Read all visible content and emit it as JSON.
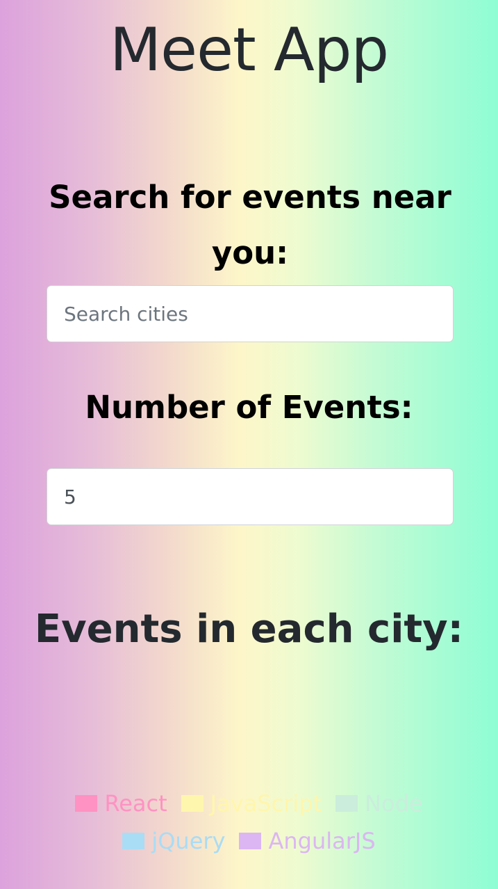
{
  "app": {
    "title": "Meet App"
  },
  "search": {
    "heading": "Search for events near you:",
    "placeholder": "Search cities"
  },
  "number_of_events": {
    "heading": "Number of Events:",
    "value": "5"
  },
  "events_chart": {
    "heading": "Events in each city:"
  },
  "legend": {
    "items": [
      {
        "label": "React",
        "color": "#ff92c2"
      },
      {
        "label": "JavaScript",
        "color": "#fff6ad"
      },
      {
        "label": "Node",
        "color": "#cbeddc"
      },
      {
        "label": "jQuery",
        "color": "#a9dcf5"
      },
      {
        "label": "AngularJS",
        "color": "#dcb6f2"
      }
    ]
  }
}
